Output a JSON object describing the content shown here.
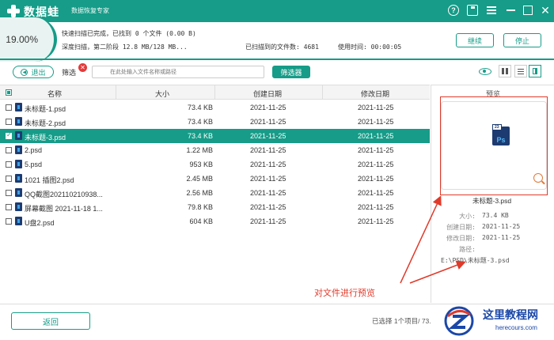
{
  "titlebar": {
    "app_name": "数据蛙",
    "subtitle": "数据恢复专家",
    "help": "?",
    "close": "✕"
  },
  "progress": {
    "percent": "19.00%",
    "line1": "快速扫描已完成，已找到 0 个文件 (0.00  B)",
    "line2": "深度扫描，第二阶段 12.8 MB/128 MB...",
    "found": "已扫描到的文件数: 4681",
    "time": "使用时间: 00:00:05",
    "continue_label": "继续",
    "stop_label": "停止"
  },
  "toolbar": {
    "back_label": "退出",
    "filter_label": "筛选",
    "filter_clear": "✕",
    "search_placeholder": "在此处输入文件名称或路径",
    "filter_button": "筛选器"
  },
  "table": {
    "columns": {
      "name": "名称",
      "size": "大小",
      "created": "创建日期",
      "modified": "修改日期"
    },
    "rows": [
      {
        "name": "未标题-1.psd",
        "size": "73.4 KB",
        "created": "2021-11-25",
        "modified": "2021-11-25"
      },
      {
        "name": "未标题-2.psd",
        "size": "73.4 KB",
        "created": "2021-11-25",
        "modified": "2021-11-25"
      },
      {
        "name": "未标题-3.psd",
        "size": "73.4 KB",
        "created": "2021-11-25",
        "modified": "2021-11-25"
      },
      {
        "name": "2.psd",
        "size": "1.22 MB",
        "created": "2021-11-25",
        "modified": "2021-11-25"
      },
      {
        "name": "5.psd",
        "size": "953 KB",
        "created": "2021-11-25",
        "modified": "2021-11-25"
      },
      {
        "name": "1021 插图2.psd",
        "size": "2.45 MB",
        "created": "2021-11-25",
        "modified": "2021-11-25"
      },
      {
        "name": "QQ截图202110210938...",
        "size": "2.56 MB",
        "created": "2021-11-25",
        "modified": "2021-11-25"
      },
      {
        "name": "屏幕截图 2021-11-18 1...",
        "size": "79.8 KB",
        "created": "2021-11-25",
        "modified": "2021-11-25"
      },
      {
        "name": "U盘2.psd",
        "size": "604 KB",
        "created": "2021-11-25",
        "modified": "2021-11-25"
      }
    ]
  },
  "preview": {
    "title": "预览",
    "ps_tag": "23",
    "ps_label": "Ps",
    "filename": "未标题-3.psd",
    "size_key": "大小:",
    "size_val": "73.4 KB",
    "created_key": "创建日期:",
    "created_val": "2021-11-25",
    "modified_key": "修改日期:",
    "modified_val": "2021-11-25",
    "path_key": "路径:",
    "path_val": "E:\\PSD\\未标题-3.psd"
  },
  "annotation": {
    "text": "对文件进行预览",
    "color": "#e03a2a"
  },
  "bottom": {
    "return_label": "返回",
    "status": "已选择 1个项目/ 73."
  },
  "watermark": {
    "title": "这里教程网",
    "url": "herecours.com"
  },
  "colors": {
    "accent": "#169c88",
    "annotation": "#e03a2a"
  }
}
